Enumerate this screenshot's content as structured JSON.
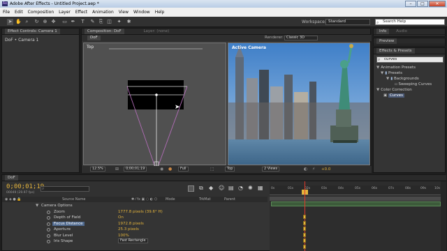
{
  "titlebar": {
    "title": "Adobe After Effects - Untitled Project.aep *",
    "logo": "Ae",
    "min": "–",
    "max": "□",
    "close": "✕"
  },
  "menu": [
    "File",
    "Edit",
    "Composition",
    "Layer",
    "Effect",
    "Animation",
    "View",
    "Window",
    "Help"
  ],
  "toolbar": {
    "workspace_label": "Workspace:",
    "workspace_value": "Standard",
    "search_placeholder": "Search Help"
  },
  "left_panel": {
    "tab": "Effect Controls: Camera 1",
    "row": "DoF • Camera 1"
  },
  "comp_panel": {
    "tab": "Composition: DoF",
    "tab2": "Layer: (none)",
    "comp_tab": "DoF",
    "renderer_label": "Renderer:",
    "renderer_value": "Classic 3D",
    "top_view_label": "Top",
    "active_camera_label": "Active Camera",
    "footer": {
      "zoom": "12.5%",
      "time": "0;00;01;19",
      "resolution": "Full",
      "view": "Top",
      "views": "2 Views",
      "exposure": "+0.0"
    }
  },
  "right_panels": {
    "info_tab": "Info",
    "audio_tab": "Audio",
    "preview_tab": "Preview",
    "effects_tab": "Effects & Presets",
    "search_value": "curves",
    "tree": [
      {
        "label": "Animation Presets",
        "level": 0
      },
      {
        "label": "Presets",
        "level": 1
      },
      {
        "label": "Backgrounds",
        "level": 2
      },
      {
        "label": "Sweeping Curves",
        "level": 3
      },
      {
        "label": "Color Correction",
        "level": 0
      },
      {
        "label": "Curves",
        "level": 1
      }
    ]
  },
  "timeline": {
    "tab": "DoF",
    "timecode": "0;00;01;19",
    "frames": "00049 (29.97 fps)",
    "columns": {
      "source": "Source Name",
      "mode": "Mode",
      "trkmat": "TrkMat",
      "parent": "Parent"
    },
    "rows": [
      {
        "name": "Camera Options",
        "value": ""
      },
      {
        "name": "Zoom",
        "value": "1777.8 pixels (39.6° H)"
      },
      {
        "name": "Depth of Field",
        "value": "On"
      },
      {
        "name": "Focus Distance",
        "value": "1972.8 pixels"
      },
      {
        "name": "Aperture",
        "value": "25.3 pixels"
      },
      {
        "name": "Blur Level",
        "value": "100%"
      },
      {
        "name": "Iris Shape",
        "value": "Fast Rectangle"
      }
    ],
    "ruler": [
      "0s",
      "01s",
      "02s",
      "03s",
      "04s",
      "05s",
      "06s",
      "07s",
      "08s",
      "09s",
      "10s"
    ]
  }
}
